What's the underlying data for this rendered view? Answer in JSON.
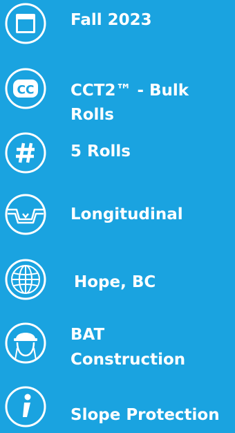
{
  "details": {
    "season": "Fall 2023",
    "product_line1": "CCT2™ - Bulk",
    "product_line2": "Rolls",
    "quantity": "5 Rolls",
    "orientation": "Longitudinal",
    "location": "Hope, BC",
    "contractor_line1": "BAT",
    "contractor_line2": "Construction",
    "application": "Slope Protection"
  },
  "icons": {
    "season": "calendar-icon",
    "product": "cc-icon",
    "quantity": "hash-icon",
    "orientation": "channel-icon",
    "location": "globe-icon",
    "contractor": "hard-hat-worker-icon",
    "application": "info-icon"
  },
  "colors": {
    "background": "#1aa3e0",
    "foreground": "#ffffff"
  }
}
